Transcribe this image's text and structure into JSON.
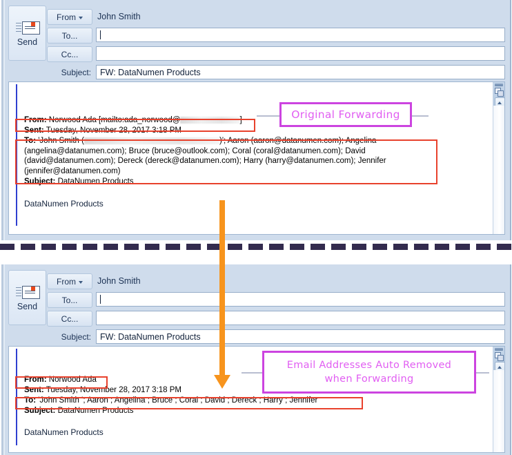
{
  "app": {
    "kind": "outlook-compose-window",
    "send_button_label": "Send",
    "send_icon": "envelope-send-icon"
  },
  "panels": [
    {
      "id": "top",
      "from_button_label": "From",
      "from_value": "John Smith",
      "to_button_label": "To...",
      "to_value": "",
      "cc_button_label": "Cc...",
      "cc_value": "",
      "subject_label": "Subject:",
      "subject_value": "FW: DataNumen Products",
      "message": {
        "from_label": "From:",
        "from_value": "Norwood Ada [mailto:ada_norwood@",
        "from_redacted": true,
        "from_tail": "]",
        "sent_label": "Sent:",
        "sent_value": "Tuesday, November 28, 2017 3:18 PM",
        "to_label": "To:",
        "to_lines": [
          "'John Smith (███)'; Aaron (aaron@datanumen.com); Angelina",
          "(angelina@datanumen.com); Bruce (bruce@outlook.com); Coral (coral@datanumen.com); David",
          "(david@datanumen.com); Dereck (dereck@datanumen.com); Harry (harry@datanumen.com); Jennifer",
          "(jennifer@datanumen.com)"
        ],
        "to_line1_prefix": "'John Smith (",
        "to_line1_suffix": ")'; Aaron (aaron@datanumen.com); Angelina",
        "to_line2": "(angelina@datanumen.com); Bruce (bruce@outlook.com); Coral (coral@datanumen.com); David",
        "to_line3": "(david@datanumen.com); Dereck (dereck@datanumen.com); Harry (harry@datanumen.com); Jennifer",
        "to_line4": "(jennifer@datanumen.com)",
        "subject_label": "Subject:",
        "subject_value": "DataNumen Products",
        "body": "DataNumen Products"
      }
    },
    {
      "id": "bottom",
      "from_button_label": "From",
      "from_value": "John Smith",
      "to_button_label": "To...",
      "to_value": "",
      "cc_button_label": "Cc...",
      "cc_value": "",
      "subject_label": "Subject:",
      "subject_value": "FW: DataNumen Products",
      "message": {
        "from_label": "From:",
        "from_value": "Norwood Ada",
        "sent_label": "Sent:",
        "sent_value": "Tuesday, November 28, 2017 3:18 PM",
        "to_label": "To:",
        "to_value": "'John Smith '; Aaron ; Angelina ; Bruce ; Coral ; David ; Dereck ; Harry ; Jennifer",
        "subject_label": "Subject:",
        "subject_value": "DataNumen Products",
        "body": "DataNumen Products"
      }
    }
  ],
  "annotations": {
    "top": "Original Forwarding",
    "bottom_line1": "Email Addresses Auto Removed",
    "bottom_line2": "when Forwarding"
  },
  "colors": {
    "window_chrome": "#cfdcec",
    "highlight_box": "#e8412c",
    "annotation_border": "#cc44e0",
    "annotation_text": "#e15ef2",
    "arrow": "#f7941d",
    "divider": "#332b4e",
    "quote_bar": "#2f3fd0"
  }
}
